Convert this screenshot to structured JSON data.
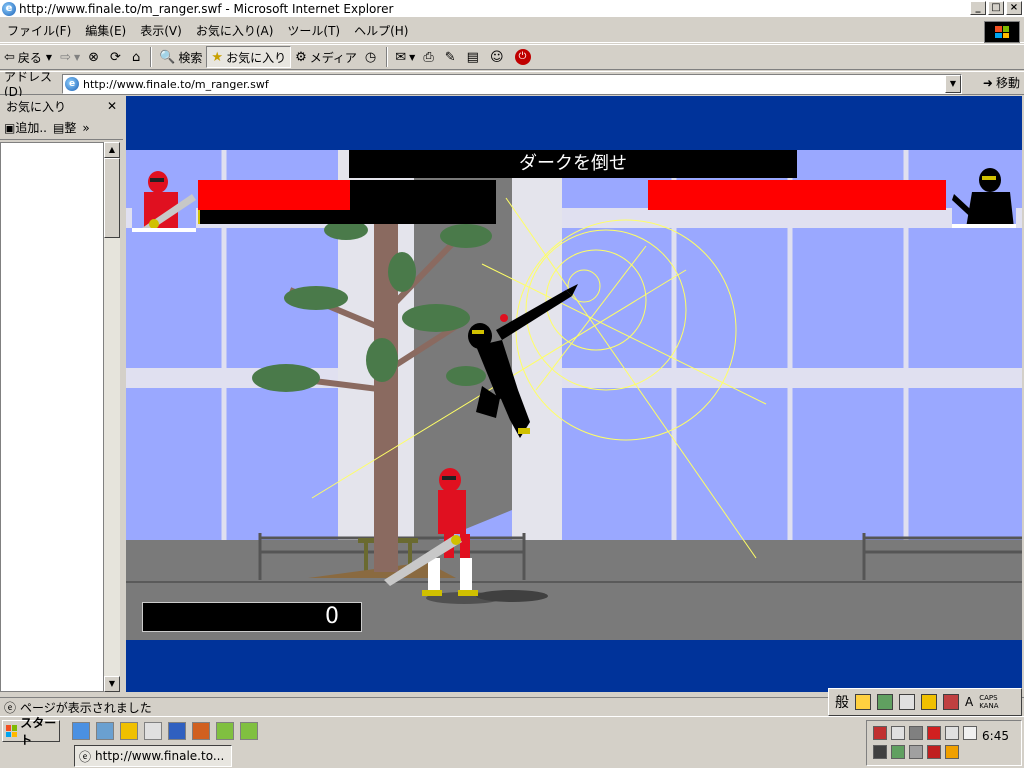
{
  "window": {
    "title": "http://www.finale.to/m_ranger.swf - Microsoft Internet Explorer",
    "controls": [
      "_",
      "□",
      "×"
    ]
  },
  "menu": [
    "ファイル(F)",
    "編集(E)",
    "表示(V)",
    "お気に入り(A)",
    "ツール(T)",
    "ヘルプ(H)"
  ],
  "toolbar": {
    "back": "戻る",
    "search": "検索",
    "favorites": "お気に入り",
    "media": "メディア"
  },
  "address": {
    "label": "アドレス(D)",
    "url": "http://www.finale.to/m_ranger.swf",
    "go": "移動"
  },
  "favorites_pane": {
    "title": "お気に入り",
    "add": "追加..",
    "organize": "整"
  },
  "game": {
    "title": "ダークを倒せ",
    "score": "0",
    "player_hp": 0.51,
    "enemy_hp": 1.0,
    "colors": {
      "frame": "#00339a",
      "sky": "#9aa8ff",
      "hp": "#ff0000",
      "ranger": "#e01020",
      "dark": "#000000",
      "effect": "#ffff66"
    }
  },
  "status": {
    "text": "ページが表示されました"
  },
  "ime": {
    "mode": "般",
    "caps": "CAPS",
    "kana": "KANA"
  },
  "taskbar": {
    "start": "スタート",
    "task_ie": "http://www.finale.to...",
    "clock": "6:45"
  }
}
